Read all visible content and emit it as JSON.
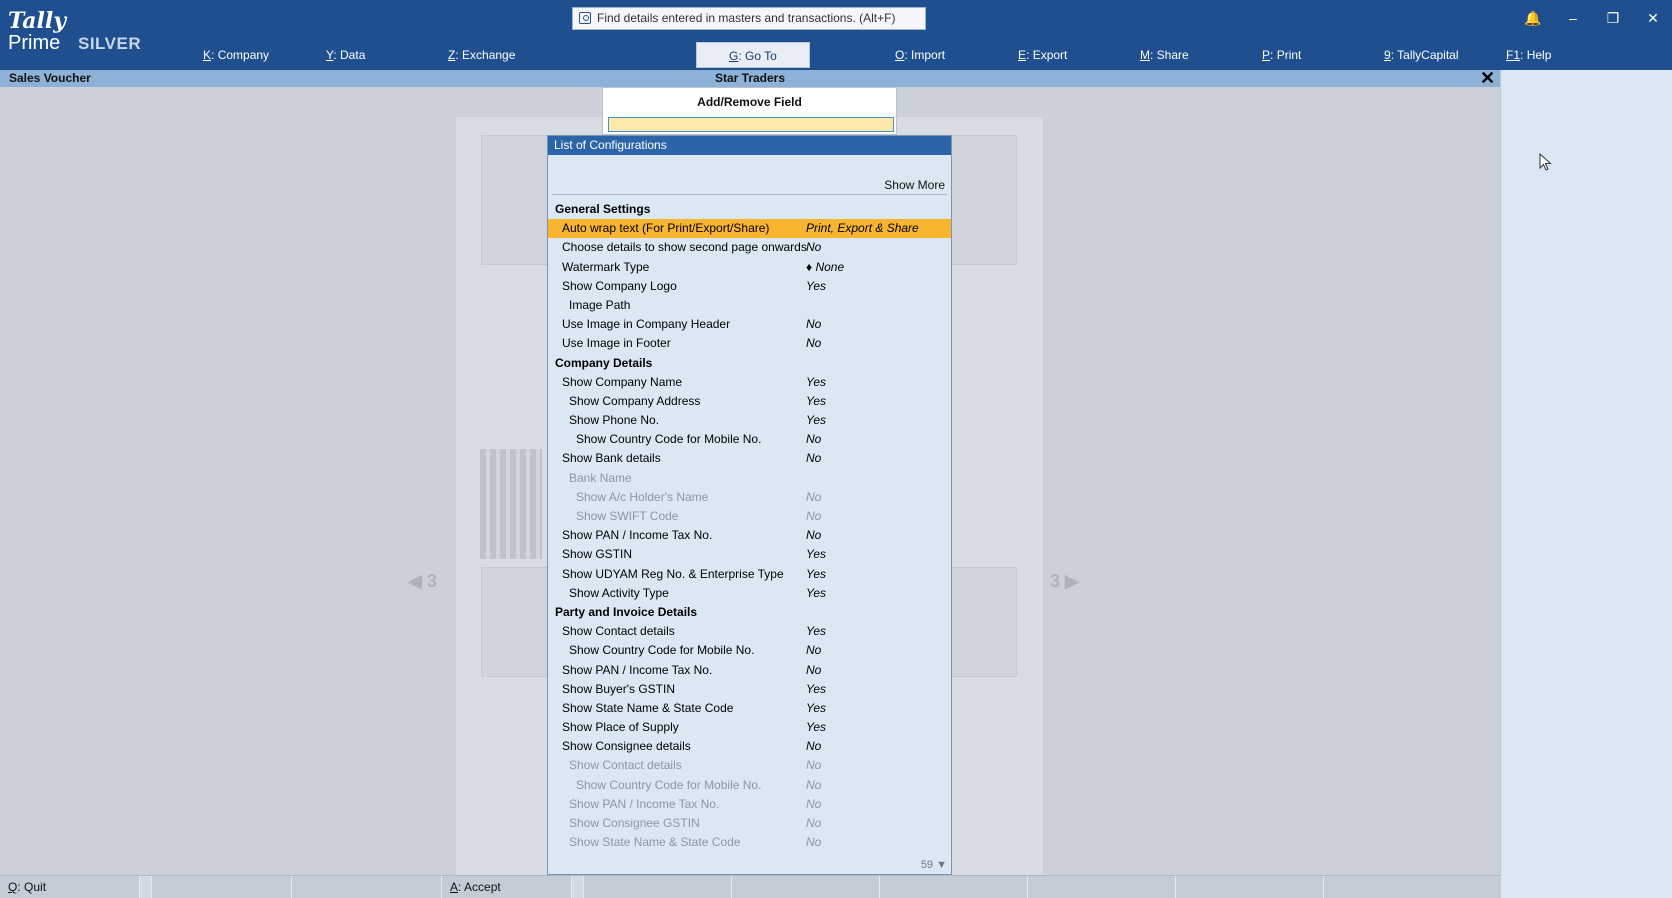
{
  "app": {
    "logo_brand": "Tally",
    "logo_product": "Prime",
    "edition": "SILVER"
  },
  "search": {
    "placeholder": "Find details entered in masters and transactions. (Alt+F)"
  },
  "menu": [
    {
      "key": "K",
      "label": "Company"
    },
    {
      "key": "Y",
      "label": "Data"
    },
    {
      "key": "Z",
      "label": "Exchange"
    },
    {
      "key": "G",
      "label": "Go To"
    },
    {
      "key": "O",
      "label": "Import"
    },
    {
      "key": "E",
      "label": "Export"
    },
    {
      "key": "M",
      "label": "Share"
    },
    {
      "key": "P",
      "label": "Print"
    },
    {
      "key": "9",
      "label": "TallyCapital"
    },
    {
      "key": "F1",
      "label": "Help"
    }
  ],
  "titlebar": {
    "screen_name": "Sales Voucher",
    "company_name": "Star Traders"
  },
  "add_remove": {
    "title": "Add/Remove Field",
    "input_value": ""
  },
  "list": {
    "title": "List of Configurations",
    "show_more": "Show More",
    "page_count": "59 ▼",
    "rows": [
      {
        "type": "section",
        "label": "General Settings",
        "value": ""
      },
      {
        "type": "item",
        "indent": 0,
        "label": "Auto wrap text (For Print/Export/Share)",
        "value": "Print, Export & Share",
        "highlight": true
      },
      {
        "type": "item",
        "indent": 0,
        "label": "Choose details to show second page onwards",
        "value": "No"
      },
      {
        "type": "item",
        "indent": 0,
        "label": "Watermark Type",
        "value": "♦ None"
      },
      {
        "type": "item",
        "indent": 0,
        "label": "Show Company Logo",
        "value": "Yes"
      },
      {
        "type": "item",
        "indent": 1,
        "label": "Image Path",
        "value": ""
      },
      {
        "type": "item",
        "indent": 0,
        "label": "Use Image in Company Header",
        "value": "No"
      },
      {
        "type": "item",
        "indent": 0,
        "label": "Use Image in Footer",
        "value": "No"
      },
      {
        "type": "section",
        "label": "Company Details",
        "value": ""
      },
      {
        "type": "item",
        "indent": 0,
        "label": "Show Company Name",
        "value": "Yes"
      },
      {
        "type": "item",
        "indent": 1,
        "label": "Show Company Address",
        "value": "Yes"
      },
      {
        "type": "item",
        "indent": 1,
        "label": "Show Phone No.",
        "value": "Yes"
      },
      {
        "type": "item",
        "indent": 2,
        "label": "Show Country Code for Mobile No.",
        "value": "No"
      },
      {
        "type": "item",
        "indent": 0,
        "label": "Show Bank details",
        "value": "No"
      },
      {
        "type": "item",
        "indent": 1,
        "label": "Bank Name",
        "value": "",
        "dim": true
      },
      {
        "type": "item",
        "indent": 2,
        "label": "Show A/c Holder's Name",
        "value": "No",
        "dim": true
      },
      {
        "type": "item",
        "indent": 2,
        "label": "Show SWIFT Code",
        "value": "No",
        "dim": true
      },
      {
        "type": "item",
        "indent": 0,
        "label": "Show PAN / Income Tax No.",
        "value": "No"
      },
      {
        "type": "item",
        "indent": 0,
        "label": "Show GSTIN",
        "value": "Yes"
      },
      {
        "type": "item",
        "indent": 0,
        "label": "Show UDYAM Reg No. & Enterprise Type",
        "value": "Yes"
      },
      {
        "type": "item",
        "indent": 1,
        "label": "Show Activity Type",
        "value": "Yes"
      },
      {
        "type": "section",
        "label": "Party and Invoice Details",
        "value": ""
      },
      {
        "type": "item",
        "indent": 0,
        "label": "Show Contact details",
        "value": "Yes"
      },
      {
        "type": "item",
        "indent": 1,
        "label": "Show Country Code for Mobile No.",
        "value": "No"
      },
      {
        "type": "item",
        "indent": 0,
        "label": "Show PAN / Income Tax No.",
        "value": "No"
      },
      {
        "type": "item",
        "indent": 0,
        "label": "Show Buyer's GSTIN",
        "value": "Yes"
      },
      {
        "type": "item",
        "indent": 0,
        "label": "Show State Name & State Code",
        "value": "Yes"
      },
      {
        "type": "item",
        "indent": 0,
        "label": "Show Place of Supply",
        "value": "Yes"
      },
      {
        "type": "item",
        "indent": 0,
        "label": "Show Consignee details",
        "value": "No"
      },
      {
        "type": "item",
        "indent": 1,
        "label": "Show Contact details",
        "value": "No",
        "dim": true
      },
      {
        "type": "item",
        "indent": 2,
        "label": "Show Country Code for Mobile No.",
        "value": "No",
        "dim": true
      },
      {
        "type": "item",
        "indent": 1,
        "label": "Show PAN / Income Tax No.",
        "value": "No",
        "dim": true
      },
      {
        "type": "item",
        "indent": 1,
        "label": "Show Consignee GSTIN",
        "value": "No",
        "dim": true
      },
      {
        "type": "item",
        "indent": 1,
        "label": "Show State Name & State Code",
        "value": "No",
        "dim": true
      }
    ]
  },
  "preview": {
    "page_left": "◀ 3",
    "page_right": "3 ▶"
  },
  "bottombar": [
    {
      "key": "Q",
      "label": "Quit"
    },
    {
      "key": "A",
      "label": "Accept"
    }
  ]
}
